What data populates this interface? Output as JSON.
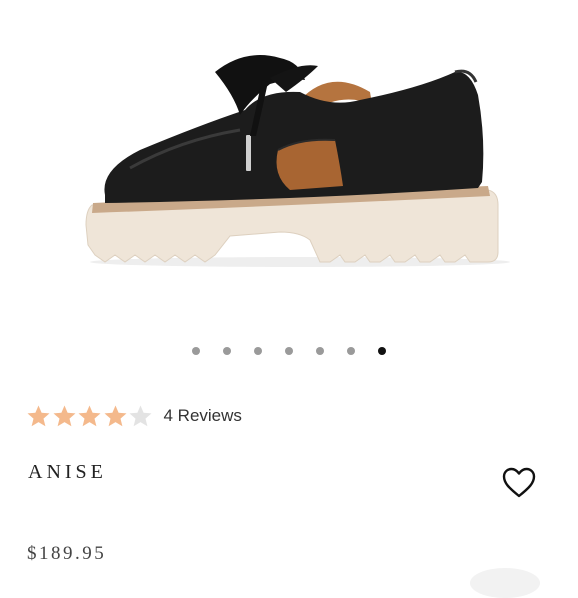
{
  "product": {
    "name": "ANISE",
    "price": "$189.95",
    "image_alt": "Black leather cut-out lace-up shoe on cream lug sole"
  },
  "carousel": {
    "total": 7,
    "active_index": 6
  },
  "rating": {
    "value": 4,
    "max": 5,
    "reviews_label": "4 Reviews"
  },
  "colors": {
    "star_filled": "#f4b98c",
    "star_empty": "#e3e3e3",
    "dot_inactive": "#9a9a9a",
    "dot_active": "#111111"
  },
  "icons": {
    "wishlist": "heart-outline-icon",
    "star": "star-icon"
  }
}
